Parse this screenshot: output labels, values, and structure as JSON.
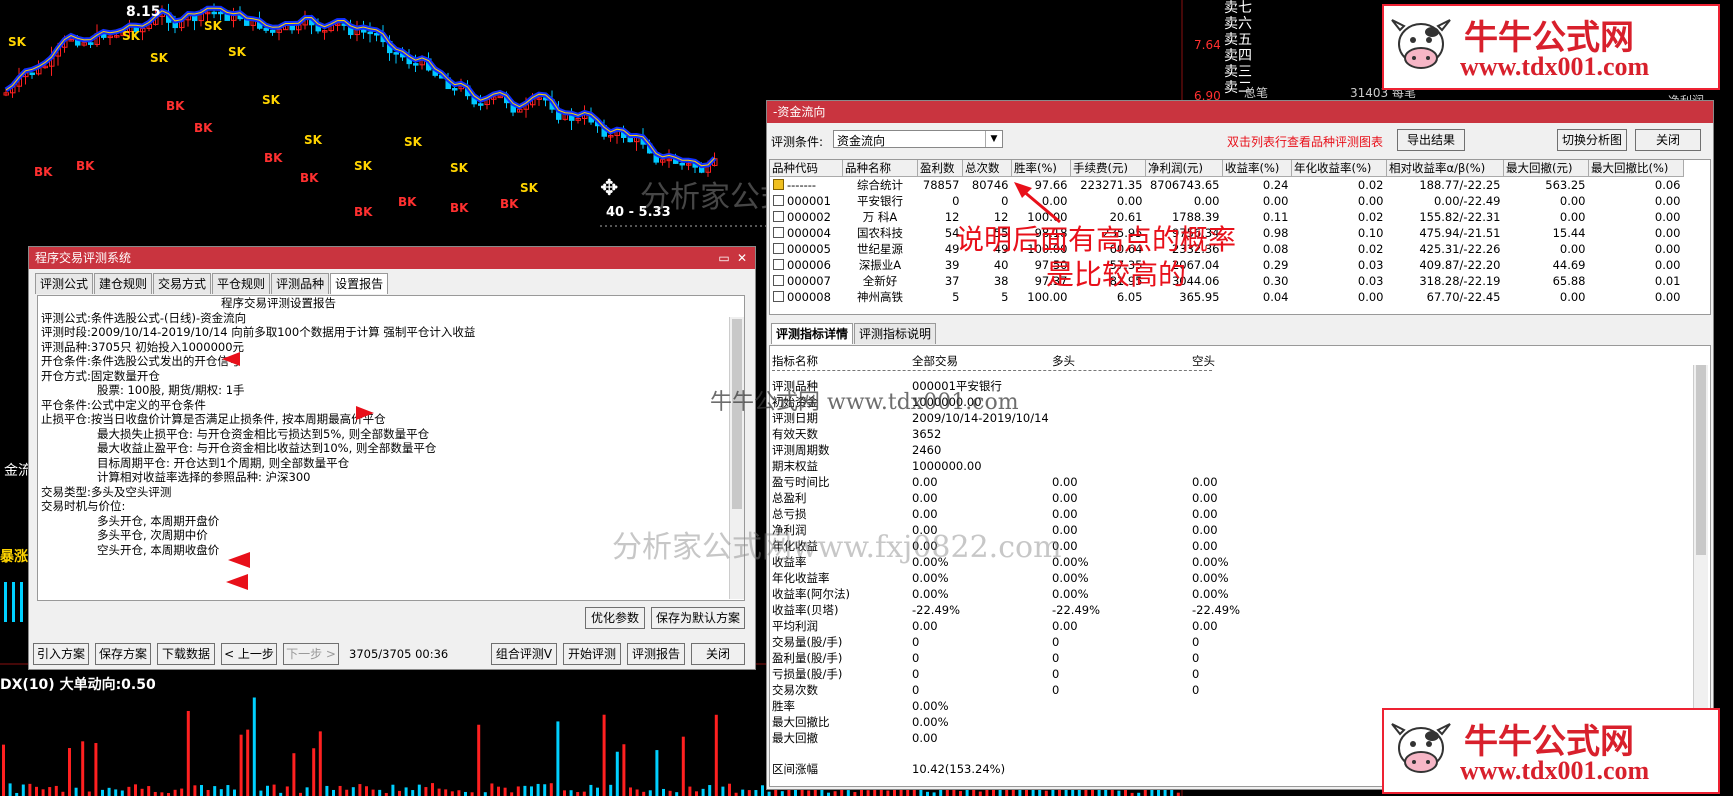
{
  "chart": {
    "high_label": "8.15",
    "price_label": "40 - 5.33",
    "sk_label": "SK",
    "bk_label": "BK",
    "indicator_label": "DX(10) 大单动向:0.50",
    "right_axis": [
      "7.64",
      "6.90"
    ],
    "order_book": [
      "卖七",
      "卖六",
      "卖五",
      "卖四",
      "卖三",
      "卖二",
      "卖一"
    ],
    "partial_left": [
      "金流",
      "暴涨"
    ],
    "partial_bottom": [
      "总笔",
      "31403 每笔",
      "净利润"
    ]
  },
  "watermarks": {
    "center_top": "分析家公式网www.fxj0822.com",
    "center_mid": "牛牛公式网 www.tdx001.com",
    "center_low": "分析家公式网www.fxj0822.com",
    "brand_title": "牛牛公式网",
    "brand_url": "www.tdx001.com"
  },
  "annotation": {
    "line1": "说明后面有高点的概率",
    "line2": "是比较高的"
  },
  "left_window": {
    "title": "程序交易评测系统",
    "tabs": [
      "评测公式",
      "建仓规则",
      "交易方式",
      "平仓规则",
      "评测品种",
      "设置报告"
    ],
    "active_tab": 5,
    "report_lines": [
      {
        "label": "",
        "text": "程序交易评测设置报告",
        "indent": 180
      },
      {
        "label": "评测公式:",
        "text": "条件选股公式-(日线)-资金流向",
        "indent": 0
      },
      {
        "label": "评测时段:",
        "text": "2009/10/14-2019/10/14 向前多取100个数据用于计算 强制平仓计入收益",
        "indent": 0
      },
      {
        "label": "评测品种:",
        "text": "3705只 初始投入1000000元",
        "indent": 0
      },
      {
        "label": "开仓条件:",
        "text": "条件选股公式发出的开仓信号",
        "indent": 0
      },
      {
        "label": "开仓方式:",
        "text": "固定数量开仓",
        "indent": 0
      },
      {
        "label": "",
        "text": "股票: 100股, 期货/期权: 1手",
        "indent": 56
      },
      {
        "label": "平仓条件:",
        "text": "公式中定义的平仓条件",
        "indent": 0
      },
      {
        "label": "止损平仓:",
        "text": "按当日收盘价计算是否满足止损条件, 按本周期最高价平仓",
        "indent": 0
      },
      {
        "label": "",
        "text": "最大损失止损平仓: 与开仓资金相比亏损达到5%, 则全部数量平仓",
        "indent": 56
      },
      {
        "label": "",
        "text": "最大收益止盈平仓: 与开仓资金相比收益达到10%, 则全部数量平仓",
        "indent": 56
      },
      {
        "label": "",
        "text": "目标周期平仓: 开仓达到1个周期, 则全部数量平仓",
        "indent": 56
      },
      {
        "label": "",
        "text": "计算相对收益率选择的参照品种: 沪深300",
        "indent": 56
      },
      {
        "label": "",
        "text": "",
        "indent": 0
      },
      {
        "label": "交易类型:",
        "text": "多头及空头评测",
        "indent": 0
      },
      {
        "label": "交易时机与价位:",
        "text": "",
        "indent": 0
      },
      {
        "label": "",
        "text": "多头开仓, 本周期开盘价",
        "indent": 56
      },
      {
        "label": "",
        "text": "多头平仓, 次周期中价",
        "indent": 56
      },
      {
        "label": "",
        "text": "空头开仓, 本周期收盘价",
        "indent": 56
      }
    ],
    "btn_optimize": "优化参数",
    "btn_save_default": "保存为默认方案",
    "btn_import": "引入方案",
    "btn_save": "保存方案",
    "btn_download": "下载数据",
    "btn_prev": "< 上一步",
    "btn_next": "下一步 >",
    "progress_text": "3705/3705 00:36",
    "btn_combo": "组合评测V",
    "btn_start": "开始评测",
    "btn_report": "评测报告",
    "btn_close": "关闭"
  },
  "right_window": {
    "title": "-资金流向",
    "condition_label": "评测条件:",
    "condition_value": "资金流向",
    "hint": "双击列表行查看品种评测图表",
    "btn_export": "导出结果",
    "btn_switch": "切换分析图",
    "btn_close": "关闭",
    "columns": [
      "品种代码",
      "品种名称",
      "盈利数",
      "总次数",
      "胜率(%)",
      "手续费(元)",
      "净利润(元)",
      "收益率(%)",
      "年化收益率(%)",
      "相对收益率α/β(%)",
      "最大回撤(元)",
      "最大回撤比(%)"
    ],
    "rows": [
      [
        "-------",
        "综合统计",
        "78857",
        "80746",
        "97.66",
        "223271.35",
        "8706743.65",
        "0.24",
        "0.02",
        "188.77/-22.25",
        "563.25",
        "0.06"
      ],
      [
        "000001",
        "平安银行",
        "0",
        "0",
        "0.00",
        "0.00",
        "0.00",
        "0.00",
        "0.00",
        "0.00/-22.49",
        "0.00",
        "0.00"
      ],
      [
        "000002",
        "万 科A",
        "12",
        "12",
        "100.00",
        "20.61",
        "1788.39",
        "0.11",
        "0.02",
        "155.82/-22.31",
        "0.00",
        "0.00"
      ],
      [
        "000004",
        "国农科技",
        "54",
        "55",
        "98.18",
        "235.95",
        "9756.34",
        "0.98",
        "0.10",
        "475.94/-21.51",
        "15.44",
        "0.00"
      ],
      [
        "000005",
        "世纪星源",
        "49",
        "49",
        "100.00",
        "60.64",
        "2332.36",
        "0.08",
        "0.02",
        "425.31/-22.26",
        "0.00",
        "0.00"
      ],
      [
        "000006",
        "深振业A",
        "39",
        "40",
        "97.50",
        "57.35",
        "2067.04",
        "0.29",
        "0.03",
        "409.87/-22.20",
        "44.69",
        "0.00"
      ],
      [
        "000007",
        "全新好",
        "37",
        "38",
        "97.37",
        "81.95",
        "3044.06",
        "0.30",
        "0.03",
        "318.28/-22.19",
        "65.88",
        "0.01"
      ],
      [
        "000008",
        "神州高铁",
        "5",
        "5",
        "100.00",
        "6.05",
        "365.95",
        "0.04",
        "0.00",
        "67.70/-22.45",
        "0.00",
        "0.00"
      ]
    ],
    "tabs": [
      "评测指标详情",
      "评测指标说明"
    ],
    "detail_headers": [
      "指标名称",
      "全部交易",
      "多头",
      "空头"
    ],
    "detail_rows": [
      [
        "评测品种",
        "000001平安银行",
        "",
        ""
      ],
      [
        "初始资金",
        "1000000.00",
        "",
        ""
      ],
      [
        "评测日期",
        "2009/10/14-2019/10/14",
        "",
        ""
      ],
      [
        "有效天数",
        "3652",
        "",
        ""
      ],
      [
        "评测周期数",
        "2460",
        "",
        ""
      ],
      [
        "期末权益",
        "1000000.00",
        "",
        ""
      ],
      [
        "盈亏时间比",
        "0.00",
        "0.00",
        "0.00"
      ],
      [
        "总盈利",
        "0.00",
        "0.00",
        "0.00"
      ],
      [
        "总亏损",
        "0.00",
        "0.00",
        "0.00"
      ],
      [
        "净利润",
        "0.00",
        "0.00",
        "0.00"
      ],
      [
        "年化收益",
        "0.00",
        "0.00",
        "0.00"
      ],
      [
        "收益率",
        "0.00%",
        "0.00%",
        "0.00%"
      ],
      [
        "年化收益率",
        "0.00%",
        "0.00%",
        "0.00%"
      ],
      [
        "收益率(阿尔法)",
        "0.00%",
        "0.00%",
        "0.00%"
      ],
      [
        "收益率(贝塔)",
        "-22.49%",
        "-22.49%",
        "-22.49%"
      ],
      [
        "平均利润",
        "0.00",
        "0.00",
        "0.00"
      ],
      [
        "交易量(股/手)",
        "0",
        "0",
        "0"
      ],
      [
        "盈利量(股/手)",
        "0",
        "0",
        "0"
      ],
      [
        "亏损量(股/手)",
        "0",
        "0",
        "0"
      ],
      [
        "交易次数",
        "0",
        "0",
        "0"
      ],
      [
        "胜率",
        "0.00%",
        "",
        ""
      ],
      [
        "最大回撤比",
        "0.00%",
        "",
        ""
      ],
      [
        "最大回撤",
        "0.00",
        "",
        ""
      ],
      [
        "",
        "",
        "",
        ""
      ],
      [
        "区间涨幅",
        "10.42(153.24%)",
        "",
        ""
      ]
    ]
  },
  "colors": {
    "title_red": "#c9343f",
    "candle_red": "#ff2020",
    "candle_cyan": "#00c8ff",
    "trend_blue": "#1030ff",
    "brand_red": "#d8202c"
  }
}
